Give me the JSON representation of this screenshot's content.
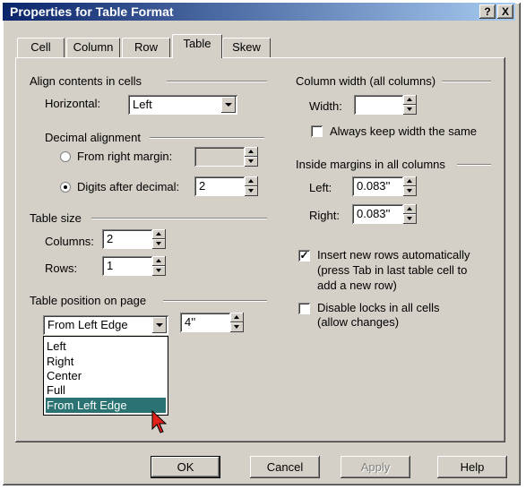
{
  "window": {
    "title": "Properties for Table Format",
    "help_btn": "?",
    "close_btn": "X"
  },
  "tabs": [
    "Cell",
    "Column",
    "Row",
    "Table",
    "Skew"
  ],
  "active_tab": "Table",
  "align": {
    "group_label": "Align contents in cells",
    "horizontal_label": "Horizontal:",
    "horizontal_value": "Left",
    "decimal_group_label": "Decimal alignment",
    "from_right_label": "From right margin:",
    "from_right_value": "",
    "digits_label": "Digits after decimal:",
    "digits_value": "2"
  },
  "size": {
    "group_label": "Table size",
    "columns_label": "Columns:",
    "columns_value": "2",
    "rows_label": "Rows:",
    "rows_value": "1"
  },
  "position": {
    "group_label": "Table position on page",
    "selected": "From Left Edge",
    "offset_value": "4''",
    "options": [
      "Left",
      "Right",
      "Center",
      "Full",
      "From Left Edge"
    ],
    "highlighted": "From Left Edge"
  },
  "colwidth": {
    "group_label": "Column width (all columns)",
    "width_label": "Width:",
    "width_value": "",
    "keep_same_label": "Always keep width the same",
    "keep_same_checked": false
  },
  "margins": {
    "group_label": "Inside margins in all columns",
    "left_label": "Left:",
    "left_value": "0.083''",
    "right_label": "Right:",
    "right_value": "0.083''"
  },
  "options": {
    "insert_rows_label_1": "Insert new rows automatically",
    "insert_rows_label_2": "(press Tab in last table cell to",
    "insert_rows_label_3": "add a new row)",
    "insert_rows_checked": true,
    "disable_locks_label_1": "Disable locks in all cells",
    "disable_locks_label_2": "(allow changes)",
    "disable_locks_checked": false
  },
  "buttons": {
    "ok": "OK",
    "cancel": "Cancel",
    "apply": "Apply",
    "help": "Help"
  },
  "colors": {
    "title_start": "#0a246a",
    "title_end": "#a6caf0",
    "face": "#d4d0c8",
    "selection": "#2b7373"
  }
}
